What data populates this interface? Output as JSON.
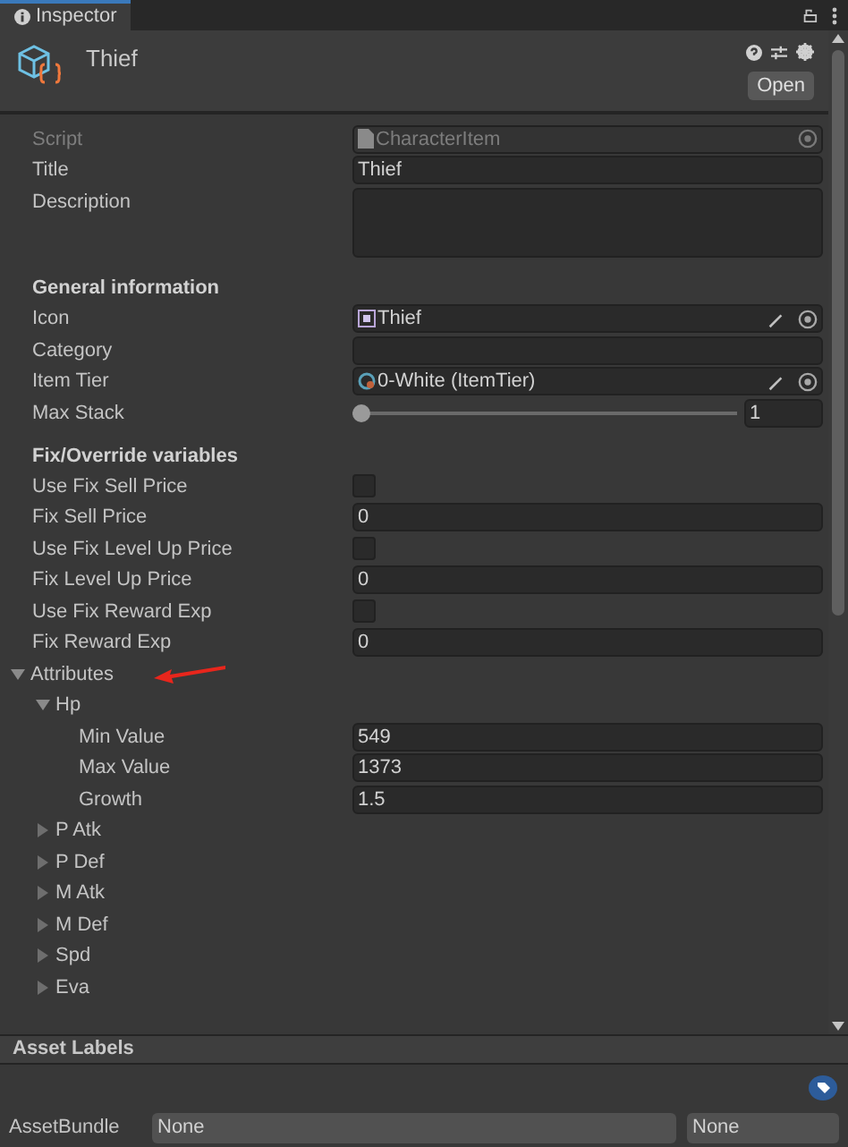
{
  "tab": {
    "label": "Inspector"
  },
  "header": {
    "title": "Thief",
    "open_button": "Open"
  },
  "fields": [
    {
      "kind": "script",
      "label": "Script",
      "value": "CharacterItem",
      "disabled": true
    },
    {
      "kind": "text",
      "label": "Title",
      "value": "Thief"
    },
    {
      "kind": "textarea",
      "label": "Description"
    },
    {
      "kind": "heading",
      "label": "General information"
    },
    {
      "kind": "sprite",
      "label": "Icon",
      "value": "Thief",
      "editable": true
    },
    {
      "kind": "text",
      "label": "Category"
    },
    {
      "kind": "asset",
      "label": "Item Tier",
      "value": "0-White (ItemTier)",
      "editable": true
    },
    {
      "kind": "slider",
      "label": "Max Stack",
      "level": 0,
      "value": "1"
    },
    {
      "kind": "heading",
      "label": "Fix/Override variables"
    },
    {
      "kind": "checkbox",
      "label": "Use Fix Sell Price",
      "checked": false
    },
    {
      "kind": "text",
      "label": "Fix Sell Price",
      "value": "0"
    },
    {
      "kind": "checkbox",
      "label": "Use Fix Level Up Price",
      "checked": false
    },
    {
      "kind": "text",
      "label": "Fix Level Up Price",
      "value": "0"
    },
    {
      "kind": "checkbox",
      "label": "Use Fix Reward Exp",
      "checked": false
    },
    {
      "kind": "text",
      "label": "Fix Reward Exp",
      "value": "0"
    }
  ],
  "attributes": {
    "label": "Attributes",
    "expanded": true,
    "children": [
      {
        "label": "Hp",
        "expanded": true,
        "fields": [
          {
            "label": "Min Value",
            "value": "549"
          },
          {
            "label": "Max Value",
            "value": "1373"
          },
          {
            "label": "Growth",
            "value": "1.5"
          }
        ]
      },
      {
        "label": "P Atk",
        "expanded": false
      },
      {
        "label": "P Def",
        "expanded": false
      },
      {
        "label": "M Atk",
        "expanded": false
      },
      {
        "label": "M Def",
        "expanded": false
      },
      {
        "label": "Spd",
        "expanded": false
      },
      {
        "label": "Eva",
        "expanded": false
      }
    ]
  },
  "asset_labels": {
    "title": "Asset Labels"
  },
  "asset_bundle": {
    "label": "AssetBundle",
    "value": "None",
    "variant": "None"
  }
}
